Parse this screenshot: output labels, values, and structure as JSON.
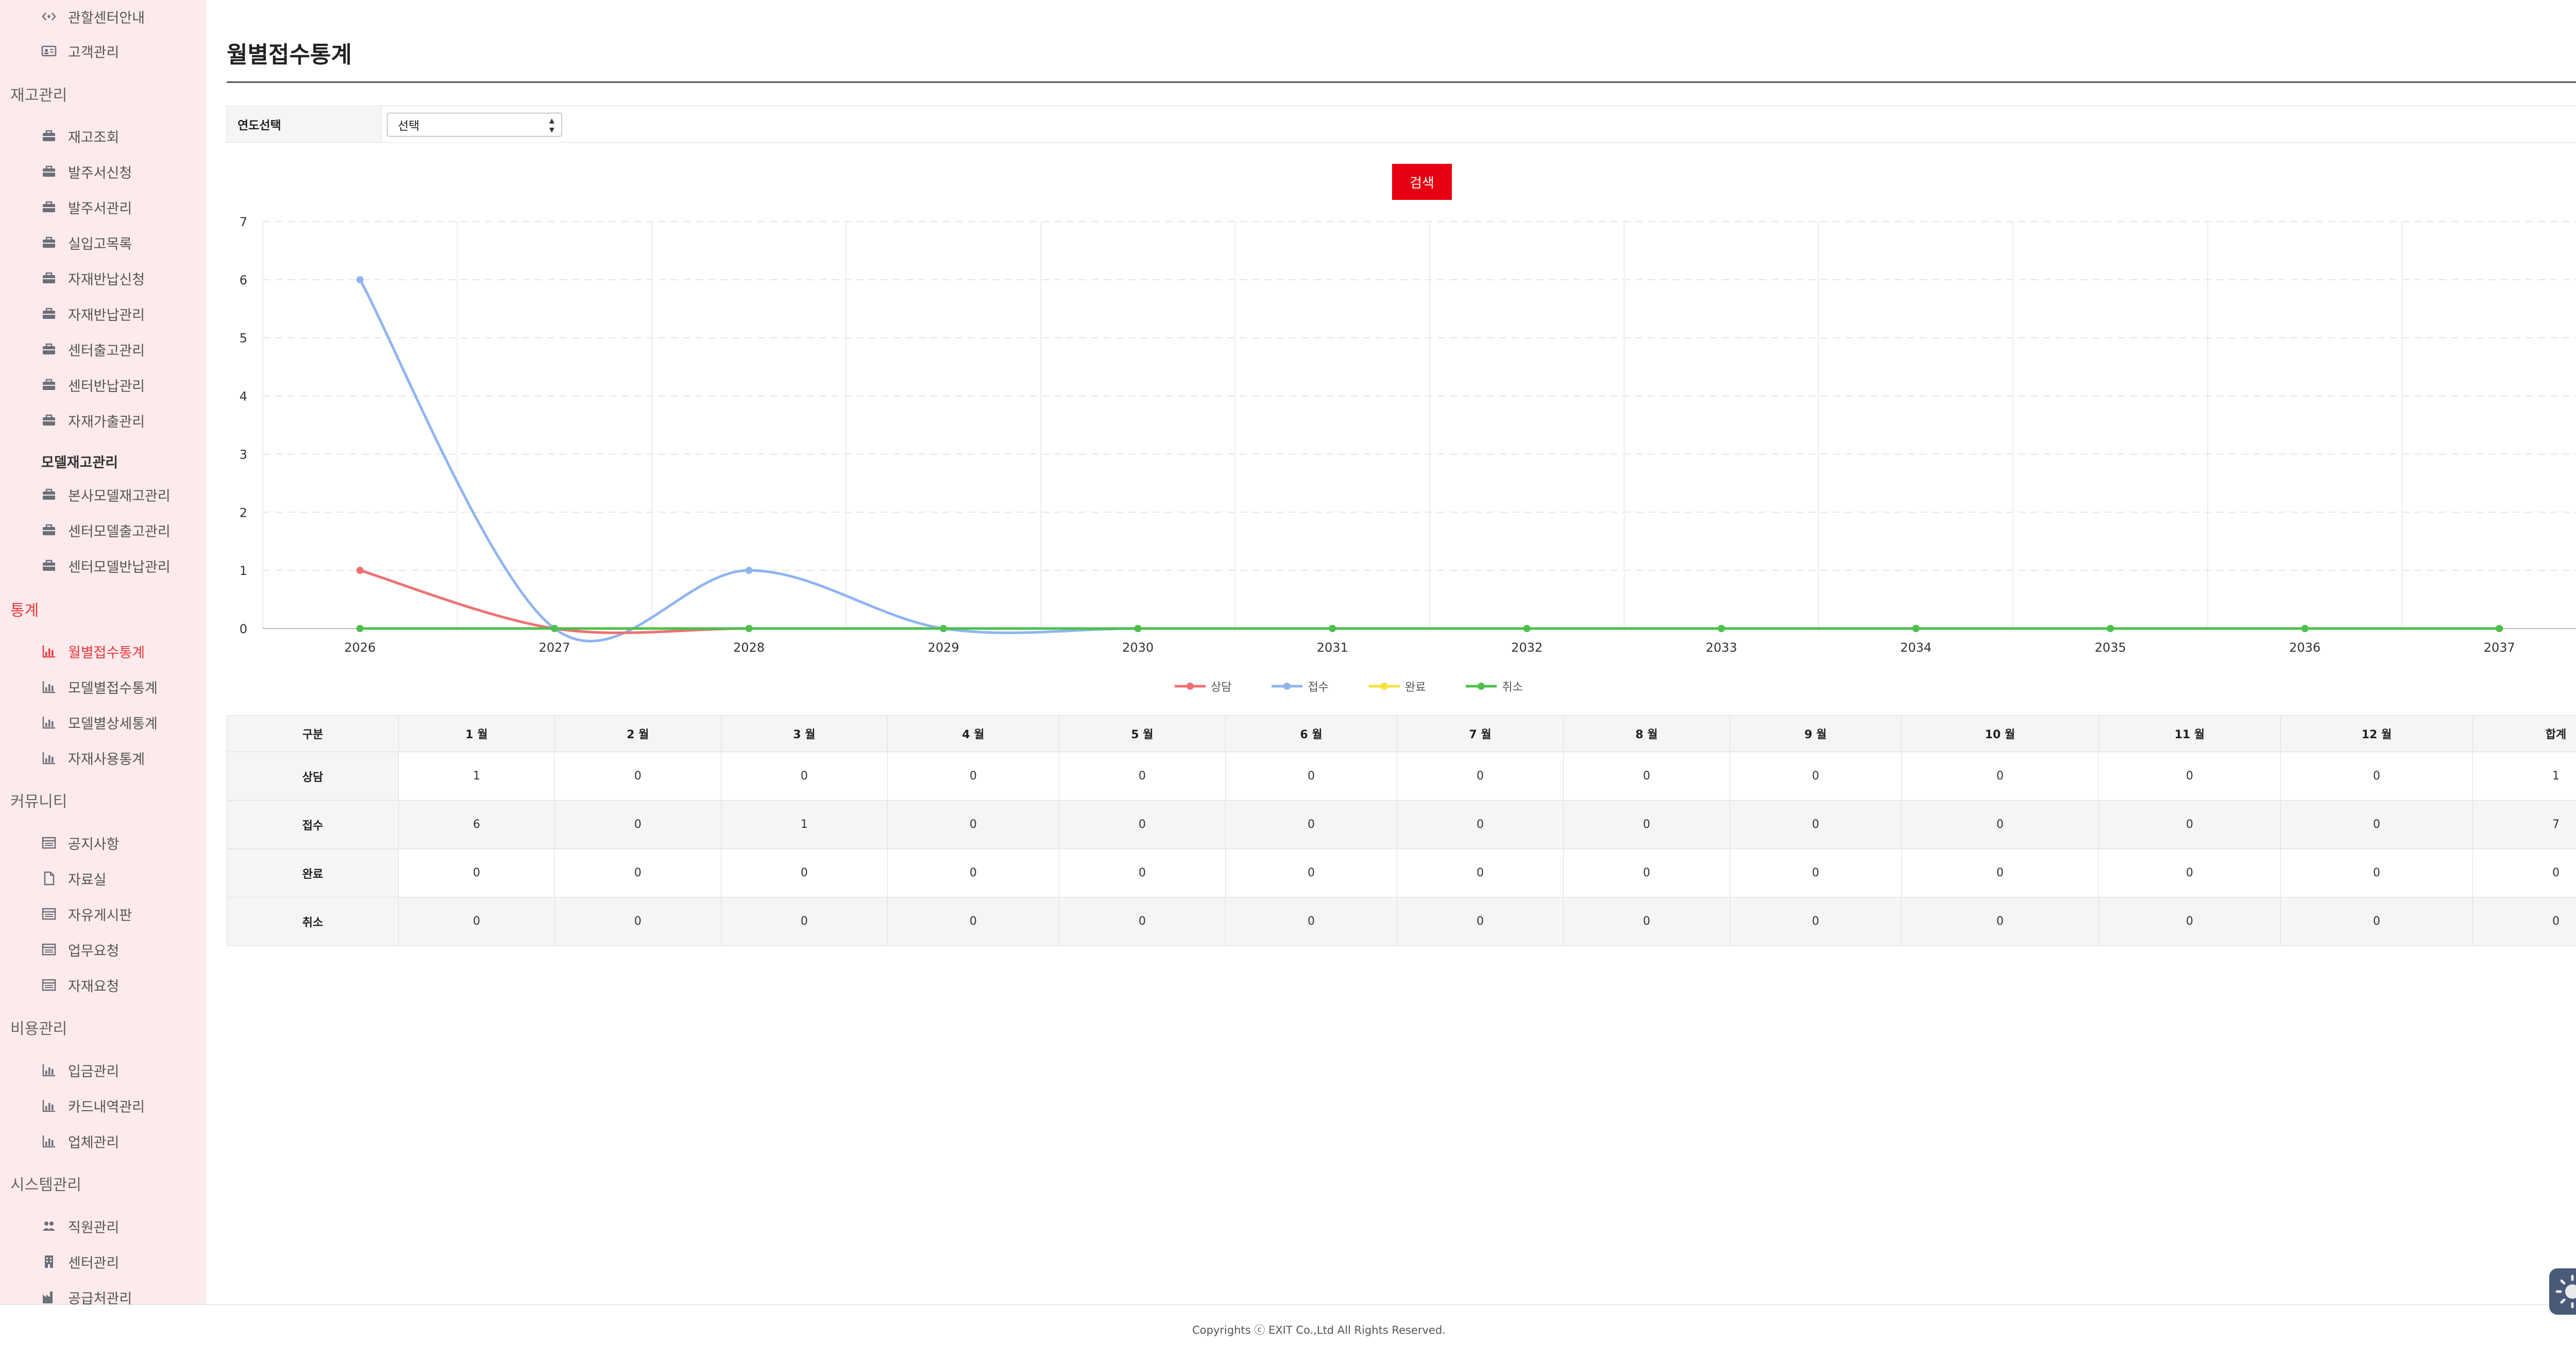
{
  "sidebar": {
    "items": [
      {
        "type": "item",
        "label": "관할센터안내",
        "icon": "eye-code-icon"
      },
      {
        "type": "item",
        "label": "고객관리",
        "icon": "id-card-icon"
      },
      {
        "type": "section",
        "label": "재고관리"
      },
      {
        "type": "item",
        "label": "재고조회",
        "icon": "briefcase-icon"
      },
      {
        "type": "item",
        "label": "발주서신청",
        "icon": "briefcase-icon"
      },
      {
        "type": "item",
        "label": "발주서관리",
        "icon": "briefcase-icon"
      },
      {
        "type": "item",
        "label": "실입고목록",
        "icon": "briefcase-icon"
      },
      {
        "type": "item",
        "label": "자재반납신청",
        "icon": "briefcase-icon"
      },
      {
        "type": "item",
        "label": "자재반납관리",
        "icon": "briefcase-icon"
      },
      {
        "type": "item",
        "label": "센터출고관리",
        "icon": "briefcase-icon"
      },
      {
        "type": "item",
        "label": "센터반납관리",
        "icon": "briefcase-icon"
      },
      {
        "type": "item",
        "label": "자재가출관리",
        "icon": "briefcase-icon"
      },
      {
        "type": "subheader",
        "label": "모델재고관리"
      },
      {
        "type": "item",
        "label": "본사모델재고관리",
        "icon": "briefcase-icon"
      },
      {
        "type": "item",
        "label": "센터모델출고관리",
        "icon": "briefcase-icon"
      },
      {
        "type": "item",
        "label": "센터모델반납관리",
        "icon": "briefcase-icon"
      },
      {
        "type": "section",
        "label": "통계",
        "active": true
      },
      {
        "type": "item",
        "label": "월별접수통계",
        "icon": "bar-chart-icon",
        "active": true
      },
      {
        "type": "item",
        "label": "모델별접수통계",
        "icon": "bar-chart-icon"
      },
      {
        "type": "item",
        "label": "모델별상세통계",
        "icon": "bar-chart-icon"
      },
      {
        "type": "item",
        "label": "자재사용통계",
        "icon": "bar-chart-icon"
      },
      {
        "type": "section",
        "label": "커뮤니티"
      },
      {
        "type": "item",
        "label": "공지사항",
        "icon": "board-icon"
      },
      {
        "type": "item",
        "label": "자료실",
        "icon": "file-icon"
      },
      {
        "type": "item",
        "label": "자유게시판",
        "icon": "board-icon"
      },
      {
        "type": "item",
        "label": "업무요청",
        "icon": "board-icon"
      },
      {
        "type": "item",
        "label": "자재요청",
        "icon": "board-icon"
      },
      {
        "type": "section",
        "label": "비용관리"
      },
      {
        "type": "item",
        "label": "입금관리",
        "icon": "bar-chart-icon"
      },
      {
        "type": "item",
        "label": "카드내역관리",
        "icon": "bar-chart-icon"
      },
      {
        "type": "item",
        "label": "업체관리",
        "icon": "bar-chart-icon"
      },
      {
        "type": "section",
        "label": "시스템관리"
      },
      {
        "type": "item",
        "label": "직원관리",
        "icon": "users-icon"
      },
      {
        "type": "item",
        "label": "센터관리",
        "icon": "building-icon"
      },
      {
        "type": "item",
        "label": "공급처관리",
        "icon": "factory-icon"
      }
    ]
  },
  "page": {
    "title": "월별접수통계"
  },
  "filter": {
    "label": "연도선택",
    "select_value": "선택"
  },
  "search_button": "검색",
  "colors": {
    "accent": "#e60012",
    "sidebar_bg": "#fdeaec",
    "active": "#e8383d"
  },
  "chart_data": {
    "type": "line",
    "x": [
      "2026",
      "2027",
      "2028",
      "2029",
      "2030",
      "2031",
      "2032",
      "2033",
      "2034",
      "2035",
      "2036",
      "2037"
    ],
    "ylim": [
      0,
      7
    ],
    "yticks": [
      0,
      1,
      2,
      3,
      4,
      5,
      6,
      7
    ],
    "grid": true,
    "legend_position": "bottom",
    "series": [
      {
        "name": "상담",
        "color": "#f07070",
        "values": [
          1,
          0,
          0,
          0,
          0,
          0,
          0,
          0,
          0,
          0,
          0,
          0
        ]
      },
      {
        "name": "접수",
        "color": "#8fb4f0",
        "values": [
          6,
          0,
          1,
          0,
          0,
          0,
          0,
          0,
          0,
          0,
          0,
          0
        ]
      },
      {
        "name": "완료",
        "color": "#f5e23a",
        "values": [
          0,
          0,
          0,
          0,
          0,
          0,
          0,
          0,
          0,
          0,
          0,
          0
        ]
      },
      {
        "name": "취소",
        "color": "#4cc04c",
        "values": [
          0,
          0,
          0,
          0,
          0,
          0,
          0,
          0,
          0,
          0,
          0,
          0
        ]
      }
    ]
  },
  "table": {
    "headers": [
      "구분",
      "1 월",
      "2 월",
      "3 월",
      "4 월",
      "5 월",
      "6 월",
      "7 월",
      "8 월",
      "9 월",
      "10 월",
      "11 월",
      "12 월",
      "합계"
    ],
    "rows": [
      {
        "label": "상담",
        "values": [
          "1",
          "0",
          "0",
          "0",
          "0",
          "0",
          "0",
          "0",
          "0",
          "0",
          "0",
          "0",
          "1"
        ]
      },
      {
        "label": "접수",
        "values": [
          "6",
          "0",
          "1",
          "0",
          "0",
          "0",
          "0",
          "0",
          "0",
          "0",
          "0",
          "0",
          "7"
        ]
      },
      {
        "label": "완료",
        "values": [
          "0",
          "0",
          "0",
          "0",
          "0",
          "0",
          "0",
          "0",
          "0",
          "0",
          "0",
          "0",
          "0"
        ]
      },
      {
        "label": "취소",
        "values": [
          "0",
          "0",
          "0",
          "0",
          "0",
          "0",
          "0",
          "0",
          "0",
          "0",
          "0",
          "0",
          "0"
        ]
      }
    ]
  },
  "footer": {
    "text": "Copyrights ⓒ EXIT Co.,Ltd All Rights Reserved."
  },
  "fab": {
    "icon": "settings-sun-icon"
  }
}
